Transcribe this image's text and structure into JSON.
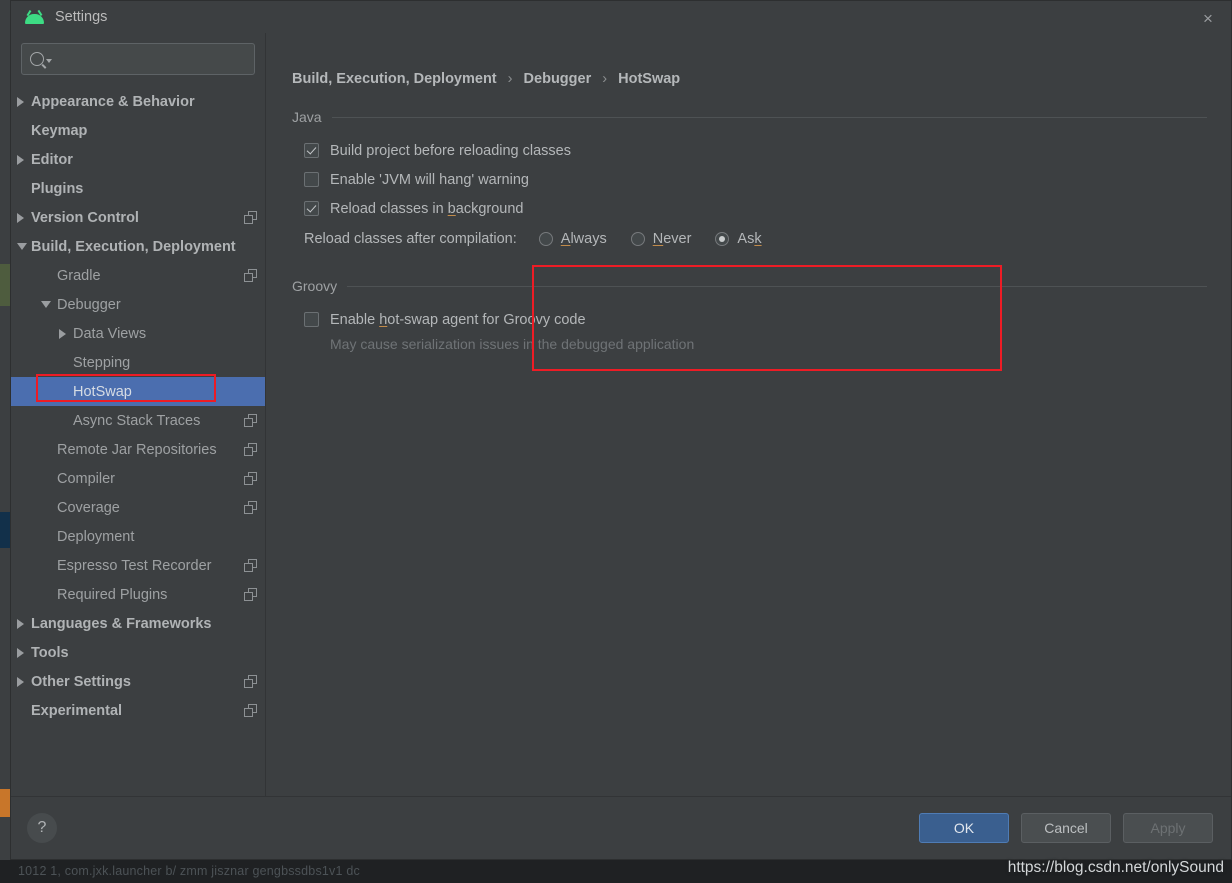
{
  "window": {
    "title": "Settings",
    "app_icon": "android-icon",
    "close_icon": "×"
  },
  "search": {
    "value": "",
    "placeholder": "",
    "icon": "search-icon"
  },
  "sidebar": {
    "items": [
      {
        "label": "Appearance & Behavior",
        "level": 0,
        "twisty": "collapsed",
        "top": true,
        "copy": false,
        "selected": false
      },
      {
        "label": "Keymap",
        "level": 0,
        "twisty": "none",
        "top": true,
        "copy": false,
        "selected": false
      },
      {
        "label": "Editor",
        "level": 0,
        "twisty": "collapsed",
        "top": true,
        "copy": false,
        "selected": false
      },
      {
        "label": "Plugins",
        "level": 0,
        "twisty": "none",
        "top": true,
        "copy": false,
        "selected": false
      },
      {
        "label": "Version Control",
        "level": 0,
        "twisty": "collapsed",
        "top": true,
        "copy": true,
        "selected": false
      },
      {
        "label": "Build, Execution, Deployment",
        "level": 0,
        "twisty": "expanded",
        "top": true,
        "copy": false,
        "selected": false
      },
      {
        "label": "Gradle",
        "level": 1,
        "twisty": "none",
        "top": false,
        "copy": true,
        "selected": false
      },
      {
        "label": "Debugger",
        "level": 1,
        "twisty": "expanded",
        "top": false,
        "copy": false,
        "selected": false
      },
      {
        "label": "Data Views",
        "level": 2,
        "twisty": "collapsed",
        "top": false,
        "copy": false,
        "selected": false
      },
      {
        "label": "Stepping",
        "level": 2,
        "twisty": "none",
        "top": false,
        "copy": false,
        "selected": false
      },
      {
        "label": "HotSwap",
        "level": 2,
        "twisty": "none",
        "top": false,
        "copy": false,
        "selected": true
      },
      {
        "label": "Async Stack Traces",
        "level": 2,
        "twisty": "none",
        "top": false,
        "copy": true,
        "selected": false
      },
      {
        "label": "Remote Jar Repositories",
        "level": 1,
        "twisty": "none",
        "top": false,
        "copy": true,
        "selected": false
      },
      {
        "label": "Compiler",
        "level": 1,
        "twisty": "none",
        "top": false,
        "copy": true,
        "selected": false
      },
      {
        "label": "Coverage",
        "level": 1,
        "twisty": "none",
        "top": false,
        "copy": true,
        "selected": false
      },
      {
        "label": "Deployment",
        "level": 1,
        "twisty": "none",
        "top": false,
        "copy": false,
        "selected": false
      },
      {
        "label": "Espresso Test Recorder",
        "level": 1,
        "twisty": "none",
        "top": false,
        "copy": true,
        "selected": false
      },
      {
        "label": "Required Plugins",
        "level": 1,
        "twisty": "none",
        "top": false,
        "copy": true,
        "selected": false
      },
      {
        "label": "Languages & Frameworks",
        "level": 0,
        "twisty": "collapsed",
        "top": true,
        "copy": false,
        "selected": false
      },
      {
        "label": "Tools",
        "level": 0,
        "twisty": "collapsed",
        "top": true,
        "copy": false,
        "selected": false
      },
      {
        "label": "Other Settings",
        "level": 0,
        "twisty": "collapsed",
        "top": true,
        "copy": true,
        "selected": false
      },
      {
        "label": "Experimental",
        "level": 0,
        "twisty": "none",
        "top": true,
        "copy": true,
        "selected": false
      }
    ]
  },
  "breadcrumb": {
    "part1": "Build, Execution, Deployment",
    "sep1": "›",
    "part2": "Debugger",
    "sep2": "›",
    "part3": "HotSwap"
  },
  "java_group": {
    "title": "Java",
    "checkboxes": [
      {
        "label": "Build project before reloading classes",
        "checked": true,
        "mnemonic": ""
      },
      {
        "label": "Enable 'JVM will hang' warning",
        "checked": false,
        "mnemonic": ""
      },
      {
        "label": "Reload classes in ",
        "checked": true,
        "mnemonic": "b",
        "after": "ackground"
      }
    ],
    "reload_label": "Reload classes after compilation:",
    "radios": [
      {
        "pre": "",
        "mnemonic": "A",
        "post": "lways",
        "selected": false
      },
      {
        "pre": "",
        "mnemonic": "N",
        "post": "ever",
        "selected": false
      },
      {
        "pre": "As",
        "mnemonic": "k",
        "post": "",
        "selected": true
      }
    ]
  },
  "groovy_group": {
    "title": "Groovy",
    "checkbox": {
      "pre": "Enable ",
      "mnemonic": "h",
      "post": "ot-swap agent for Groovy code",
      "checked": false
    },
    "hint": "May cause serialization issues in the debugged application"
  },
  "footer": {
    "help_label": "?",
    "ok_label": "OK",
    "cancel_label": "Cancel",
    "apply_label": "Apply"
  },
  "watermark": "https://blog.csdn.net/onlySound",
  "ide_status_text": "1012 1, com.jxk.launcher  b/ zmm  jisznar gengbssdbs1v1 dc",
  "colors": {
    "accent_blue": "#4b6eaf",
    "annotation_red": "#ee1c25",
    "android_green": "#3ddc84",
    "mnemonic": "#c28b4a"
  }
}
